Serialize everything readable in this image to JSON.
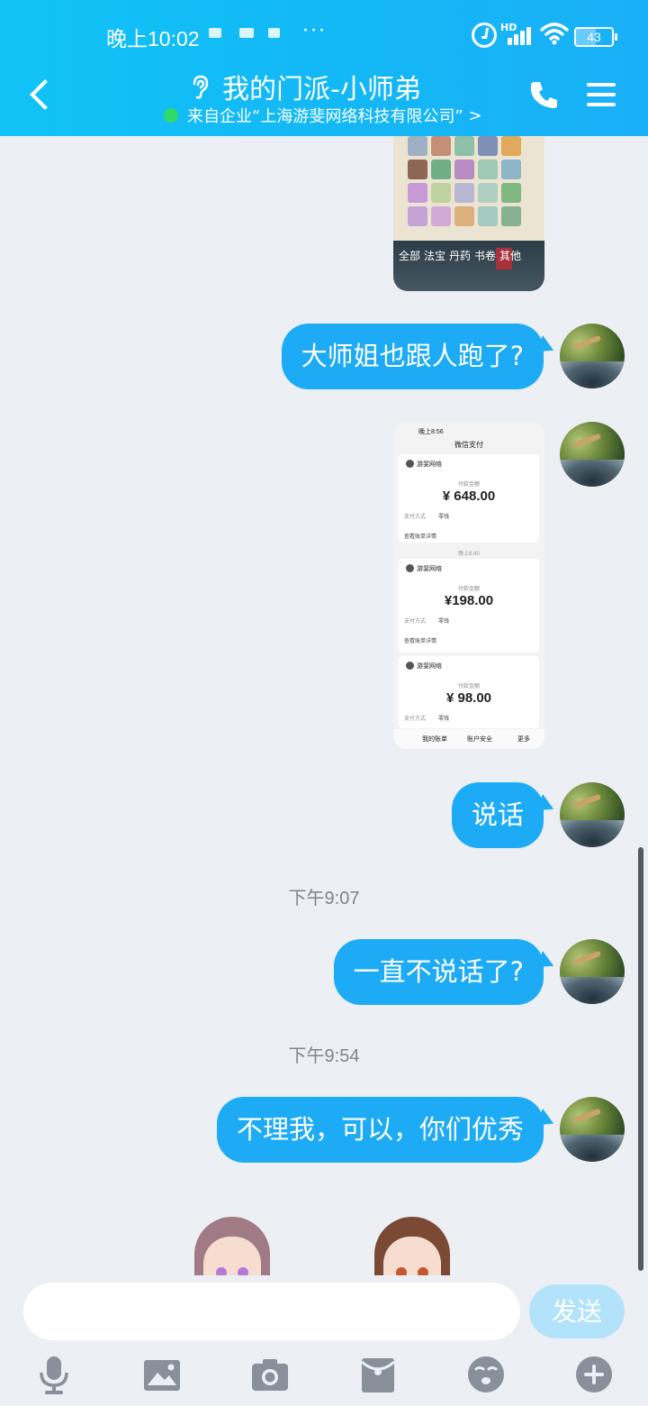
{
  "status_bar": {
    "time": "晚上10:02",
    "more": "···",
    "network": "HD",
    "battery": "43"
  },
  "header": {
    "title": "我的门派-小师弟",
    "subtitle": "来自企业“上海游斐网络科技有限公司”",
    "subtitle_arrow": ">"
  },
  "game_image": {
    "tabs": [
      "全部",
      "法宝",
      "丹药",
      "书卷",
      "其他"
    ]
  },
  "payment_image": {
    "status_time": "晚上8:56",
    "title": "微信支付",
    "cards": [
      {
        "merchant": "游斐网络",
        "label": "付款金额",
        "amount": "¥ 648.00",
        "method_label": "支付方式",
        "method": "零钱",
        "details": "查看账单详情"
      },
      {
        "merchant": "游斐网络",
        "label": "付款金额",
        "amount": "¥198.00",
        "method_label": "支付方式",
        "method": "零钱",
        "details": "查看账单详情"
      },
      {
        "merchant": "游斐网络",
        "label": "付款金额",
        "amount": "¥ 98.00",
        "method_label": "支付方式",
        "method": "零钱"
      }
    ],
    "divider_time": "晚上8:40",
    "footer": [
      "我的账单",
      "账户安全",
      "更多"
    ]
  },
  "messages": [
    {
      "text": "大师姐也跟人跑了?"
    },
    {
      "text": "说话"
    },
    {
      "timestamp": "下午9:07"
    },
    {
      "text": "一直不说话了?"
    },
    {
      "timestamp": "下午9:54"
    },
    {
      "text": "不理我，可以，你们优秀"
    }
  ],
  "input": {
    "placeholder": "",
    "send_label": "发送"
  },
  "toolbar": [
    "microphone-icon",
    "image-icon",
    "camera-icon",
    "red-packet-icon",
    "emoji-icon",
    "plus-icon"
  ],
  "colors": {
    "header": "#13b8f6",
    "bubble": "#1dabf5",
    "background": "#eceff4",
    "send_disabled": "#b3e3fa"
  }
}
